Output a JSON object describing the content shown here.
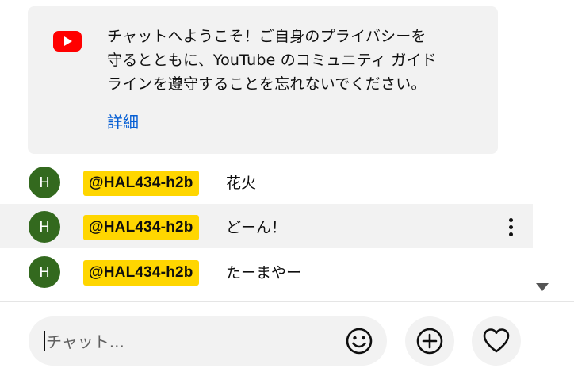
{
  "welcome": {
    "line1": "チャットへようこそ！ご自身のプライバシーを",
    "line2": "守るとともに、YouTube のコミュニティ ガイド",
    "line3": "ラインを遵守することを忘れないでください。",
    "details_label": "詳細",
    "logo_icon": "youtube-logo-icon",
    "accent_color": "#ff0000",
    "link_color": "#065fd4"
  },
  "messages": [
    {
      "avatar": "H",
      "author": "@HAL434-h2b",
      "text": "花火"
    },
    {
      "avatar": "H",
      "author": "@HAL434-h2b",
      "text": "どーん！"
    },
    {
      "avatar": "H",
      "author": "@HAL434-h2b",
      "text": "たーまやー"
    }
  ],
  "colors": {
    "author_chip": "#ffd600",
    "avatar_bg": "#33691e",
    "card_bg": "#f2f2f2"
  },
  "input": {
    "placeholder": "チャット...",
    "value": ""
  },
  "icons": {
    "emoji": "smiley-face-icon",
    "super_chat": "add-circle-icon",
    "heart": "heart-icon",
    "more": "more-vertical-icon",
    "scroll": "scroll-down-arrow-icon"
  }
}
